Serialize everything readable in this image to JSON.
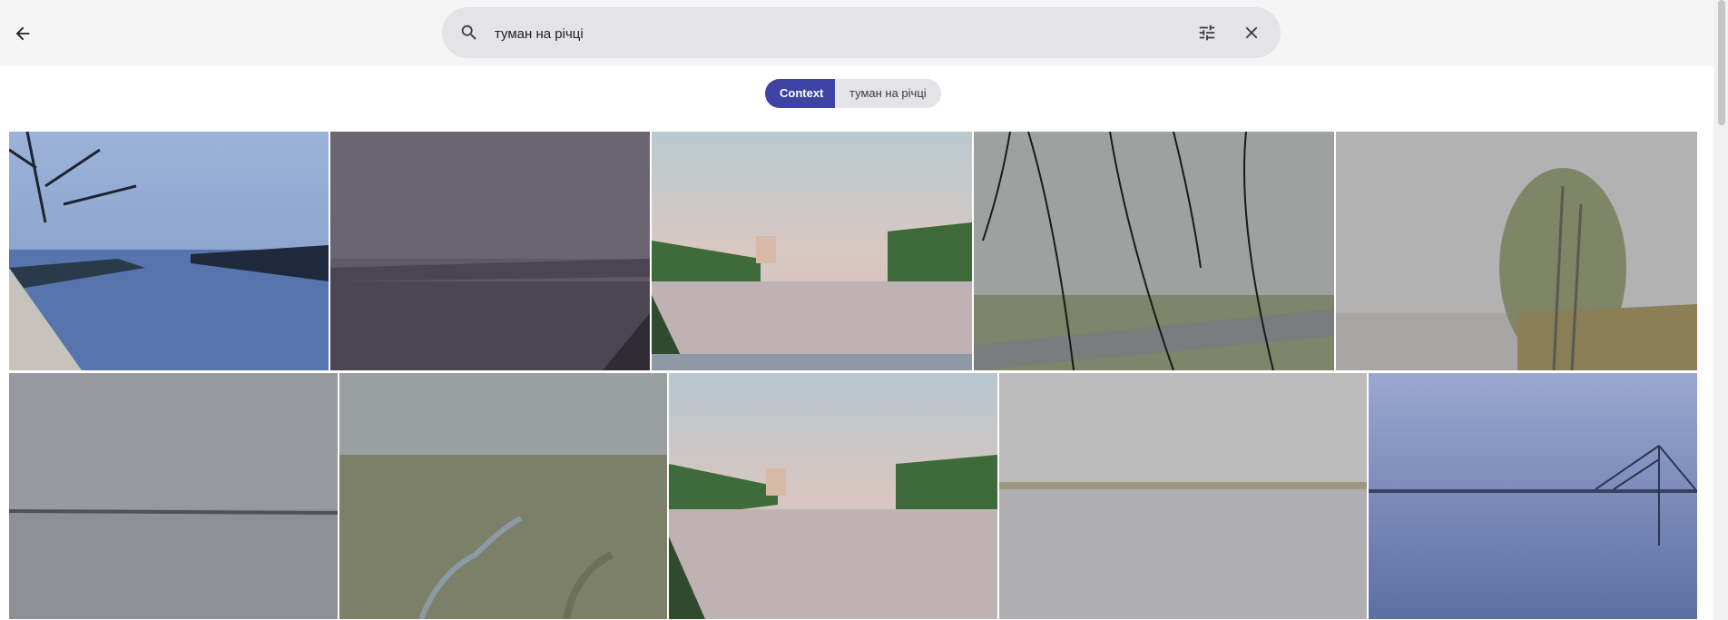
{
  "header": {
    "back_icon": "arrow-back-icon",
    "search": {
      "value": "туман на річці",
      "icon": "search-icon",
      "tune_icon": "tune-icon",
      "clear_icon": "close-icon"
    }
  },
  "chips": {
    "context_label": "Context",
    "query_label": "туман на річці"
  },
  "colors": {
    "chip_active": "#3f43a1",
    "search_bg": "#e4e4e6",
    "topbar_bg": "#f5f5f5"
  },
  "results": {
    "row1_count": 5,
    "row2_count": 5
  }
}
